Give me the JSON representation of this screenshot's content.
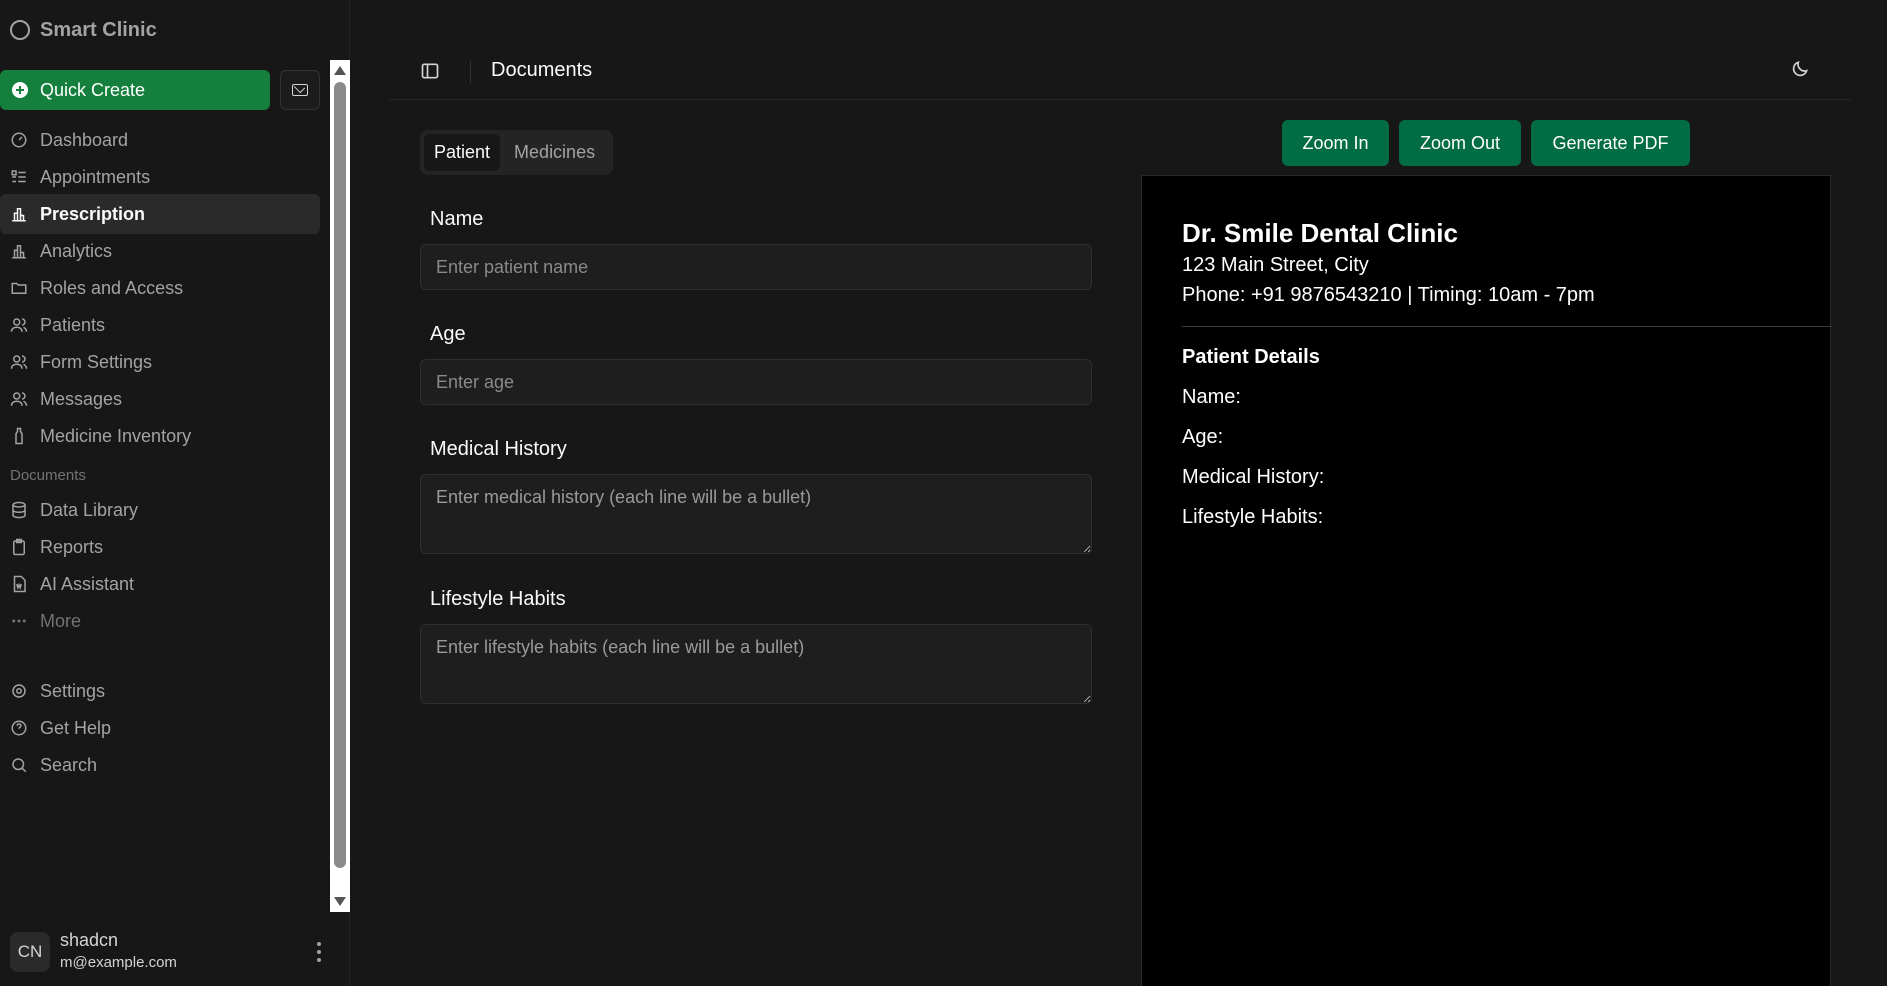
{
  "brand": {
    "name": "Smart Clinic"
  },
  "sidebar": {
    "quick_create": "Quick Create",
    "main_items": [
      {
        "label": "Dashboard",
        "icon": "gauge-icon"
      },
      {
        "label": "Appointments",
        "icon": "list-icon"
      },
      {
        "label": "Prescription",
        "icon": "bar-chart-icon",
        "active": true
      },
      {
        "label": "Analytics",
        "icon": "bar-chart-icon"
      },
      {
        "label": "Roles and Access",
        "icon": "folder-icon"
      },
      {
        "label": "Patients",
        "icon": "users-icon"
      },
      {
        "label": "Form Settings",
        "icon": "users-icon"
      },
      {
        "label": "Messages",
        "icon": "users-icon"
      },
      {
        "label": "Medicine Inventory",
        "icon": "bottle-icon"
      }
    ],
    "documents_label": "Documents",
    "doc_items": [
      {
        "label": "Data Library",
        "icon": "database-icon"
      },
      {
        "label": "Reports",
        "icon": "clipboard-icon"
      },
      {
        "label": "AI Assistant",
        "icon": "file-word-icon"
      },
      {
        "label": "More",
        "icon": "dots-icon"
      }
    ],
    "footer_items": [
      {
        "label": "Settings",
        "icon": "gear-icon"
      },
      {
        "label": "Get Help",
        "icon": "help-icon"
      },
      {
        "label": "Search",
        "icon": "search-icon"
      }
    ],
    "user": {
      "initials": "CN",
      "name": "shadcn",
      "email": "m@example.com"
    }
  },
  "header": {
    "title": "Documents"
  },
  "tabs": [
    {
      "label": "Patient",
      "active": true
    },
    {
      "label": "Medicines",
      "active": false
    }
  ],
  "form": {
    "name_label": "Name",
    "name_placeholder": "Enter patient name",
    "age_label": "Age",
    "age_placeholder": "Enter age",
    "history_label": "Medical History",
    "history_placeholder": "Enter medical history (each line will be a bullet)",
    "lifestyle_label": "Lifestyle Habits",
    "lifestyle_placeholder": "Enter lifestyle habits (each line will be a bullet)"
  },
  "actions": {
    "zoom_in": "Zoom In",
    "zoom_out": "Zoom Out",
    "generate_pdf": "Generate PDF"
  },
  "preview": {
    "clinic_name": "Dr. Smile Dental Clinic",
    "address": "123 Main Street, City",
    "phone_line": "Phone: +91 9876543210 | Timing: 10am - 7pm",
    "section_title": "Patient Details",
    "name_row": "Name:",
    "age_row": "Age:",
    "history_row": "Medical History:",
    "lifestyle_row": "Lifestyle Habits:"
  },
  "colors": {
    "accent": "#15803d",
    "action": "#026c44",
    "background": "#171717",
    "preview_bg": "#000000"
  }
}
